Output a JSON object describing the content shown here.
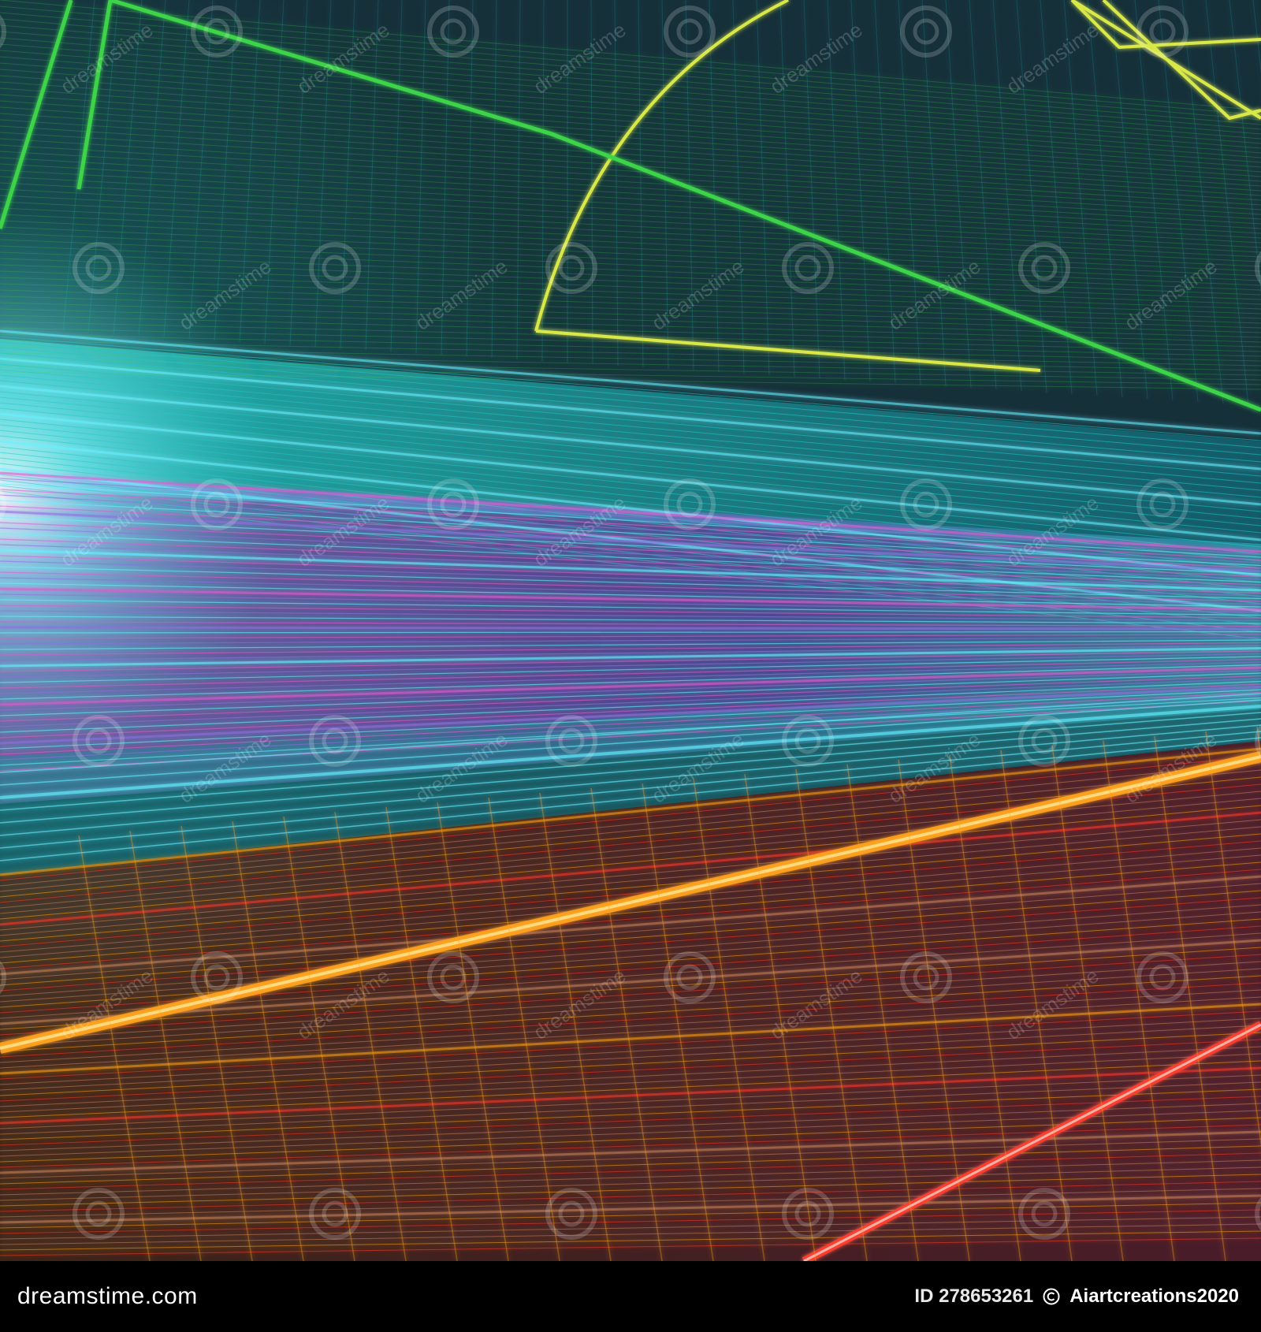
{
  "watermark": {
    "text": "dreamstime",
    "icon": "swirl-logo-icon",
    "opacity": 0.18
  },
  "footer": {
    "brand": "dreamstime.com",
    "id_label": "ID 278653261",
    "copyright_icon": "copyright-icon",
    "author": "Aiartcreations2020"
  },
  "palette": {
    "background": "#101820",
    "teal": "#1fc9c9",
    "cyan": "#66f0ff",
    "green": "#3ed44a",
    "yellow": "#d9e84a",
    "magenta": "#e05ad0",
    "violet": "#8e6fe0",
    "orange": "#ffa21a",
    "red": "#ff3a2a",
    "footer": "#000000"
  }
}
